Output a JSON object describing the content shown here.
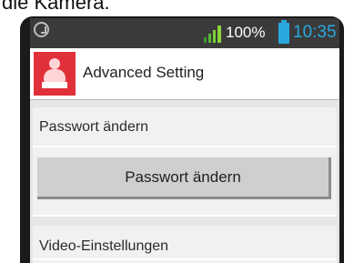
{
  "caption": {
    "cropped_text": "die Kamera."
  },
  "status_bar": {
    "battery_percent": "100%",
    "time": "10:35",
    "accent_color": "#2aa8de",
    "icons": [
      "sync-icon",
      "signal-icon",
      "battery-icon"
    ]
  },
  "header": {
    "title": "Advanced Setting",
    "icon": "user-settings-icon",
    "icon_color": "#e0303a"
  },
  "sections": {
    "password": {
      "header": "Passwort ändern",
      "button_label": "Passwort ändern"
    },
    "video": {
      "header": "Video-Einstellungen"
    }
  }
}
